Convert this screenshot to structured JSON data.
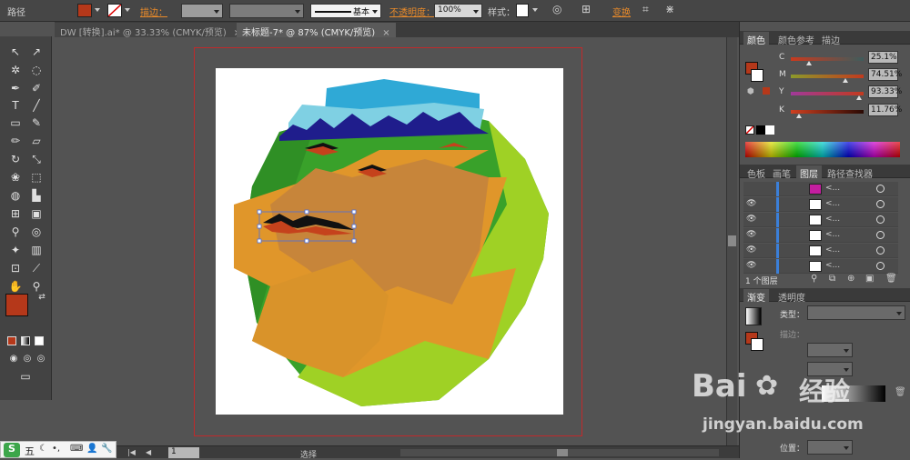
{
  "control_bar": {
    "object_type": "路径",
    "stroke_label": "描边：",
    "stroke_style": "基本",
    "opacity_label": "不透明度：",
    "opacity_value": "100%",
    "style_label": "样式：",
    "transform_label": "变换",
    "fill_color": "#b5381a"
  },
  "tabs": [
    {
      "label": "DW [转换].ai* @ 33.33% (CMYK/预览)",
      "close": "×"
    },
    {
      "label": "未标题-7* @ 87% (CMYK/预览)",
      "close": "×"
    }
  ],
  "color_panel": {
    "tabs": [
      "颜色",
      "颜色参考",
      "描边"
    ],
    "channels": [
      {
        "label": "C",
        "value": "25.1",
        "unit": "%",
        "fraction": 0.25
      },
      {
        "label": "M",
        "value": "74.51",
        "unit": "%",
        "fraction": 0.745
      },
      {
        "label": "Y",
        "value": "93.33",
        "unit": "%",
        "fraction": 0.933
      },
      {
        "label": "K",
        "value": "11.76",
        "unit": "%",
        "fraction": 0.118
      }
    ]
  },
  "layers_panel": {
    "tabs": [
      "色板",
      "画笔",
      "图层",
      "路径查找器"
    ],
    "footer": "1 个图层",
    "row_dots": "<..."
  },
  "gradient_panel": {
    "tabs": [
      "渐变",
      "透明度"
    ],
    "type_label": "类型：",
    "stroke_label": "描边：",
    "position_label": "位置："
  },
  "status_bar": {
    "page_value": "1",
    "mode_label": "选择"
  },
  "ime_bar": {
    "logo": "S",
    "mode": "五"
  },
  "watermark": {
    "brand": "Bai",
    "brand2": "经验",
    "url": "jingyan.baidu.com"
  }
}
